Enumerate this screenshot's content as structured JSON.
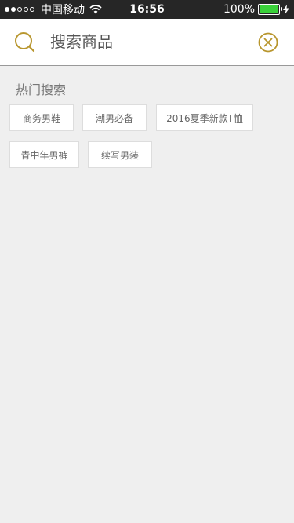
{
  "status_bar": {
    "signal_full": 2,
    "signal_empty": 3,
    "carrier": "中国移动",
    "wifi_icon": "wifi-icon",
    "time": "16:56",
    "battery_percent": "100%",
    "battery_level": 1.0,
    "battery_color": "#3ad13a",
    "charging_icon": "bolt-icon"
  },
  "search": {
    "placeholder": "搜索商品",
    "value": "",
    "search_icon": "search-icon",
    "clear_icon": "close-circle-icon",
    "accent_color": "#b8962e"
  },
  "hot_search": {
    "title": "热门搜索",
    "tags": [
      "商务男鞋",
      "潮男必备",
      "2016夏季新款T恤",
      "青中年男裤",
      "续写男装"
    ]
  }
}
